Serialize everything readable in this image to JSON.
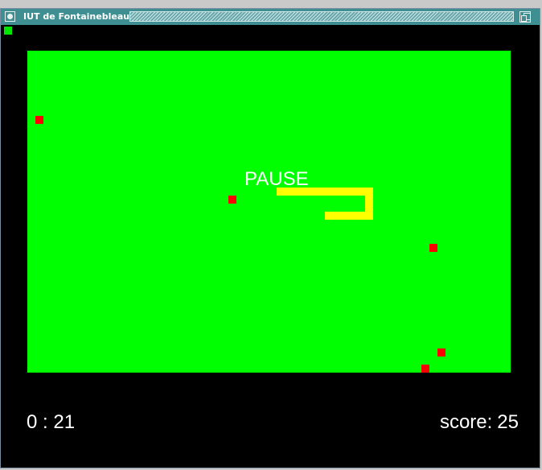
{
  "window": {
    "title": "IUT de Fontainebleau"
  },
  "game": {
    "pause_text": "PAUSE",
    "timer": "0 : 21",
    "score_label": "score:",
    "score_value": "25",
    "apple_count": 5,
    "colors": {
      "background": "#000000",
      "field": "#00ff00",
      "apple": "#ff0000",
      "snake": "#ffff00",
      "text": "#ffffff"
    }
  }
}
